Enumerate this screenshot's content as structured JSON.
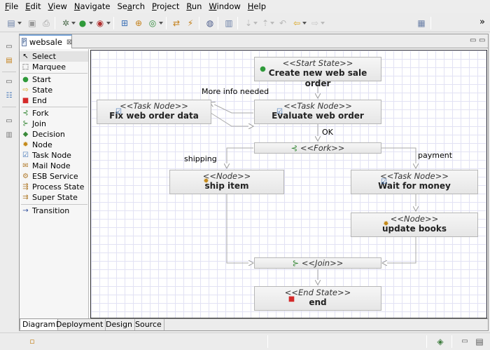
{
  "menu": [
    {
      "label": "File",
      "mnemonic": "F",
      "rest": "ile"
    },
    {
      "label": "Edit",
      "mnemonic": "E",
      "rest": "dit"
    },
    {
      "label": "View",
      "mnemonic": "V",
      "rest": "iew"
    },
    {
      "label": "Navigate",
      "mnemonic": "N",
      "rest": "avigate"
    },
    {
      "label": "Search",
      "mnemonic": "a",
      "pre": "Se",
      "rest": "rch"
    },
    {
      "label": "Project",
      "mnemonic": "P",
      "rest": "roject"
    },
    {
      "label": "Run",
      "mnemonic": "R",
      "rest": "un"
    },
    {
      "label": "Window",
      "mnemonic": "W",
      "rest": "indow"
    },
    {
      "label": "Help",
      "mnemonic": "H",
      "rest": "elp"
    }
  ],
  "toolbar_overflow": "»",
  "editor": {
    "tab_label": "websale",
    "tab_close": "⊠",
    "file_icon_text": "P",
    "minimize_icon": "▭",
    "maximize_icon": "▭"
  },
  "palette": {
    "items": [
      {
        "label": "Select",
        "icon": "select-arrow-icon",
        "glyph": "↖",
        "color": "#000000"
      },
      {
        "label": "Marquee",
        "icon": "marquee-icon",
        "glyph": "⬚",
        "color": "#000000"
      },
      {
        "label": "Start",
        "icon": "start-icon",
        "glyph": "●",
        "color": "#2f9a3a"
      },
      {
        "label": "State",
        "icon": "state-icon",
        "glyph": "⇨",
        "color": "#d9a51c"
      },
      {
        "label": "End",
        "icon": "end-icon",
        "glyph": "■",
        "color": "#d42a2a"
      },
      {
        "label": "Fork",
        "icon": "fork-icon",
        "glyph": "⊰",
        "color": "#3a8a3a"
      },
      {
        "label": "Join",
        "icon": "join-icon",
        "glyph": "⊱",
        "color": "#3a8a3a"
      },
      {
        "label": "Decision",
        "icon": "decision-icon",
        "glyph": "◆",
        "color": "#3a8a3a"
      },
      {
        "label": "Node",
        "icon": "node-gear-icon",
        "glyph": "✹",
        "color": "#c48a1a"
      },
      {
        "label": "Task Node",
        "icon": "task-node-icon",
        "glyph": "☑",
        "color": "#3a6fb5"
      },
      {
        "label": "Mail Node",
        "icon": "mail-node-icon",
        "glyph": "✉",
        "color": "#b07a2a"
      },
      {
        "label": "ESB Service",
        "icon": "esb-service-icon",
        "glyph": "⚙",
        "color": "#b07a2a"
      },
      {
        "label": "Process State",
        "icon": "process-state-icon",
        "glyph": "⇶",
        "color": "#b07a2a"
      },
      {
        "label": "Super State",
        "icon": "super-state-icon",
        "glyph": "⇉",
        "color": "#b07a2a"
      },
      {
        "label": "Transition",
        "icon": "transition-icon",
        "glyph": "→",
        "color": "#2a4a9a"
      }
    ]
  },
  "diagram": {
    "nodes": [
      {
        "id": "start",
        "stereotype": "<<Start State>>",
        "title": "Create new web sale order",
        "icon": "start-icon",
        "glyph": "●",
        "color": "#2f9a3a"
      },
      {
        "id": "fix",
        "stereotype": "<<Task Node>>",
        "title": "Fix web order data",
        "icon": "task-node-icon",
        "glyph": "☑",
        "color": "#3a6fb5"
      },
      {
        "id": "evaluate",
        "stereotype": "<<Task Node>>",
        "title": "Evaluate web order",
        "icon": "task-node-icon",
        "glyph": "☑",
        "color": "#3a6fb5"
      },
      {
        "id": "fork",
        "stereotype": "<<Fork>>",
        "title": "",
        "icon": "fork-icon",
        "glyph": "⊰",
        "color": "#3a8a3a"
      },
      {
        "id": "ship",
        "stereotype": "<<Node>>",
        "title": "ship item",
        "icon": "node-gear-icon",
        "glyph": "✹",
        "color": "#c48a1a"
      },
      {
        "id": "wait",
        "stereotype": "<<Task Node>>",
        "title": "Wait for money",
        "icon": "task-node-icon",
        "glyph": "☑",
        "color": "#3a6fb5"
      },
      {
        "id": "update",
        "stereotype": "<<Node>>",
        "title": "update books",
        "icon": "node-gear-icon",
        "glyph": "✹",
        "color": "#c48a1a"
      },
      {
        "id": "join",
        "stereotype": "<<Join>>",
        "title": "",
        "icon": "join-icon",
        "glyph": "⊱",
        "color": "#3a8a3a"
      },
      {
        "id": "end",
        "stereotype": "<<End State>>",
        "title": "end",
        "icon": "end-icon",
        "glyph": "■",
        "color": "#d42a2a"
      }
    ],
    "transition_labels": {
      "more_info": "More info needed",
      "ok": "OK",
      "shipping": "shipping",
      "payment": "payment"
    }
  },
  "bottom_tabs": [
    "Diagram",
    "Deployment",
    "Design",
    "Source"
  ],
  "colors": {
    "grid": "#e2e2f4",
    "node_border": "#b6b6b6",
    "transition_line": "#aaaaaa"
  }
}
